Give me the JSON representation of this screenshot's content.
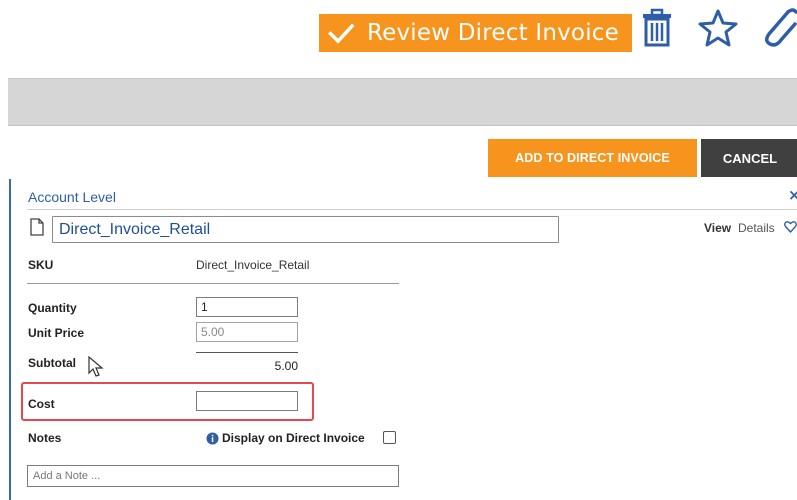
{
  "header": {
    "title": "Review Direct Invoice",
    "icons": [
      "check-icon",
      "trash-icon",
      "star-icon",
      "paperclip-icon"
    ],
    "accent_color": "#f7941d"
  },
  "actions": {
    "add_label": "ADD TO DIRECT INVOICE",
    "cancel_label": "CANCEL"
  },
  "panel": {
    "section_title": "Account Level",
    "item_name": "Direct_Invoice_Retail",
    "view_label": "View",
    "details_label": "Details"
  },
  "fields": {
    "sku_label": "SKU",
    "sku_value": "Direct_Invoice_Retail",
    "quantity_label": "Quantity",
    "quantity_value": "1",
    "unit_price_label": "Unit Price",
    "unit_price_value": "5.00",
    "subtotal_label": "Subtotal",
    "subtotal_value": "5.00",
    "cost_label": "Cost",
    "cost_value": "",
    "notes_label": "Notes",
    "display_on_invoice_label": "Display on Direct Invoice",
    "display_on_invoice_checked": false,
    "note_placeholder": "Add a Note ...",
    "highlight_color": "#e5484d"
  }
}
